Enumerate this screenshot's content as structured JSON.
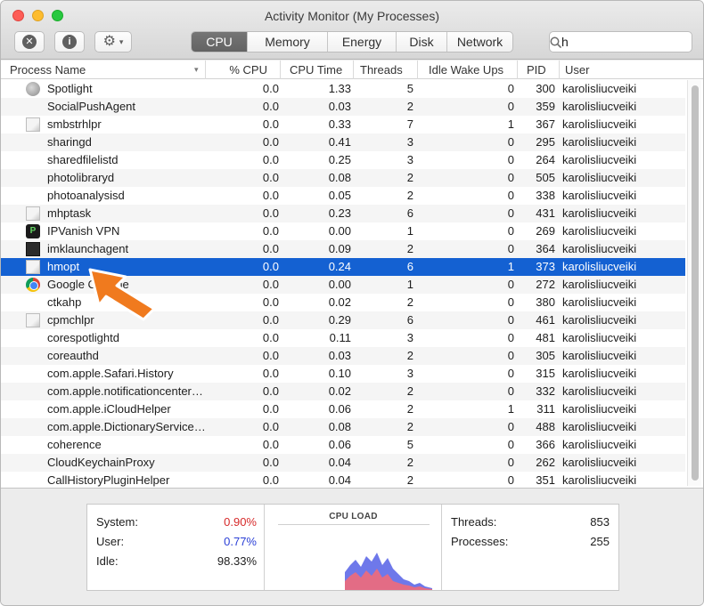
{
  "window": {
    "title": "Activity Monitor (My Processes)"
  },
  "toolbar": {
    "stop_icon": "x-circle-icon",
    "info_icon": "info-icon",
    "gear_icon": "gear-icon",
    "tabs": [
      {
        "label": "CPU",
        "active": true
      },
      {
        "label": "Memory",
        "active": false
      },
      {
        "label": "Energy",
        "active": false
      },
      {
        "label": "Disk",
        "active": false
      },
      {
        "label": "Network",
        "active": false
      }
    ],
    "search_value": "h"
  },
  "columns": [
    "Process Name",
    "% CPU",
    "CPU Time",
    "Threads",
    "Idle Wake Ups",
    "PID",
    "User"
  ],
  "processes": [
    {
      "name": "Spotlight",
      "cpu": "0.0",
      "cpu_time": "1.33",
      "threads": "5",
      "idle": "0",
      "pid": "300",
      "user": "karolisliucveiki",
      "icon": "spotlight"
    },
    {
      "name": "SocialPushAgent",
      "cpu": "0.0",
      "cpu_time": "0.03",
      "threads": "2",
      "idle": "0",
      "pid": "359",
      "user": "karolisliucveiki",
      "icon": ""
    },
    {
      "name": "smbstrhlpr",
      "cpu": "0.0",
      "cpu_time": "0.33",
      "threads": "7",
      "idle": "1",
      "pid": "367",
      "user": "karolisliucveiki",
      "icon": "doc"
    },
    {
      "name": "sharingd",
      "cpu": "0.0",
      "cpu_time": "0.41",
      "threads": "3",
      "idle": "0",
      "pid": "295",
      "user": "karolisliucveiki",
      "icon": ""
    },
    {
      "name": "sharedfilelistd",
      "cpu": "0.0",
      "cpu_time": "0.25",
      "threads": "3",
      "idle": "0",
      "pid": "264",
      "user": "karolisliucveiki",
      "icon": ""
    },
    {
      "name": "photolibraryd",
      "cpu": "0.0",
      "cpu_time": "0.08",
      "threads": "2",
      "idle": "0",
      "pid": "505",
      "user": "karolisliucveiki",
      "icon": ""
    },
    {
      "name": "photoanalysisd",
      "cpu": "0.0",
      "cpu_time": "0.05",
      "threads": "2",
      "idle": "0",
      "pid": "338",
      "user": "karolisliucveiki",
      "icon": ""
    },
    {
      "name": "mhptask",
      "cpu": "0.0",
      "cpu_time": "0.23",
      "threads": "6",
      "idle": "0",
      "pid": "431",
      "user": "karolisliucveiki",
      "icon": "doc"
    },
    {
      "name": "IPVanish VPN",
      "cpu": "0.0",
      "cpu_time": "0.00",
      "threads": "1",
      "idle": "0",
      "pid": "269",
      "user": "karolisliucveiki",
      "icon": "vpn"
    },
    {
      "name": "imklaunchagent",
      "cpu": "0.0",
      "cpu_time": "0.09",
      "threads": "2",
      "idle": "0",
      "pid": "364",
      "user": "karolisliucveiki",
      "icon": "term"
    },
    {
      "name": "hmopt",
      "cpu": "0.0",
      "cpu_time": "0.24",
      "threads": "6",
      "idle": "1",
      "pid": "373",
      "user": "karolisliucveiki",
      "icon": "doc",
      "selected": true
    },
    {
      "name": "Google Chrome",
      "cpu": "0.0",
      "cpu_time": "0.00",
      "threads": "1",
      "idle": "0",
      "pid": "272",
      "user": "karolisliucveiki",
      "icon": "chrome"
    },
    {
      "name": "ctkahp",
      "cpu": "0.0",
      "cpu_time": "0.02",
      "threads": "2",
      "idle": "0",
      "pid": "380",
      "user": "karolisliucveiki",
      "icon": ""
    },
    {
      "name": "cpmchlpr",
      "cpu": "0.0",
      "cpu_time": "0.29",
      "threads": "6",
      "idle": "0",
      "pid": "461",
      "user": "karolisliucveiki",
      "icon": "doc"
    },
    {
      "name": "corespotlightd",
      "cpu": "0.0",
      "cpu_time": "0.11",
      "threads": "3",
      "idle": "0",
      "pid": "481",
      "user": "karolisliucveiki",
      "icon": ""
    },
    {
      "name": "coreauthd",
      "cpu": "0.0",
      "cpu_time": "0.03",
      "threads": "2",
      "idle": "0",
      "pid": "305",
      "user": "karolisliucveiki",
      "icon": ""
    },
    {
      "name": "com.apple.Safari.History",
      "cpu": "0.0",
      "cpu_time": "0.10",
      "threads": "3",
      "idle": "0",
      "pid": "315",
      "user": "karolisliucveiki",
      "icon": ""
    },
    {
      "name": "com.apple.notificationcenter…",
      "cpu": "0.0",
      "cpu_time": "0.02",
      "threads": "2",
      "idle": "0",
      "pid": "332",
      "user": "karolisliucveiki",
      "icon": ""
    },
    {
      "name": "com.apple.iCloudHelper",
      "cpu": "0.0",
      "cpu_time": "0.06",
      "threads": "2",
      "idle": "1",
      "pid": "311",
      "user": "karolisliucveiki",
      "icon": ""
    },
    {
      "name": "com.apple.DictionaryService…",
      "cpu": "0.0",
      "cpu_time": "0.08",
      "threads": "2",
      "idle": "0",
      "pid": "488",
      "user": "karolisliucveiki",
      "icon": ""
    },
    {
      "name": "coherence",
      "cpu": "0.0",
      "cpu_time": "0.06",
      "threads": "5",
      "idle": "0",
      "pid": "366",
      "user": "karolisliucveiki",
      "icon": ""
    },
    {
      "name": "CloudKeychainProxy",
      "cpu": "0.0",
      "cpu_time": "0.04",
      "threads": "2",
      "idle": "0",
      "pid": "262",
      "user": "karolisliucveiki",
      "icon": ""
    },
    {
      "name": "CallHistoryPluginHelper",
      "cpu": "0.0",
      "cpu_time": "0.04",
      "threads": "2",
      "idle": "0",
      "pid": "351",
      "user": "karolisliucveiki",
      "icon": ""
    }
  ],
  "stats": {
    "system_label": "System:",
    "system_value": "0.90%",
    "user_label": "User:",
    "user_value": "0.77%",
    "idle_label": "Idle:",
    "idle_value": "98.33%",
    "cpu_load_title": "CPU LOAD",
    "threads_label": "Threads:",
    "threads_value": "853",
    "processes_label": "Processes:",
    "processes_value": "255",
    "colors": {
      "system": "#d62a2a",
      "user": "#2a3fd6"
    }
  }
}
